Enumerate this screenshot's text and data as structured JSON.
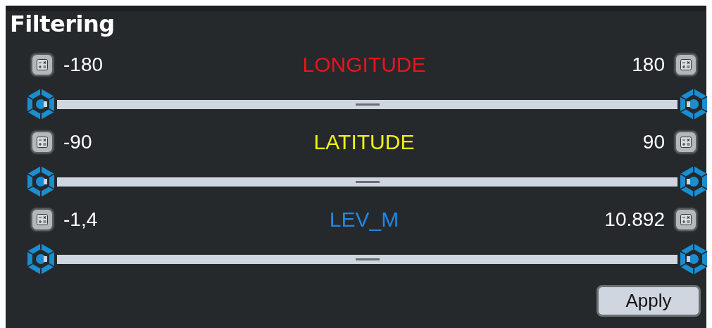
{
  "title": "Filtering",
  "filters": [
    {
      "label": "LONGITUDE",
      "color": "#e8141c",
      "min": "-180",
      "max": "180"
    },
    {
      "label": "LATITUDE",
      "color": "#f2f20f",
      "min": "-90",
      "max": "90"
    },
    {
      "label": "LEV_M",
      "color": "#1e88e8",
      "min": "-1,4",
      "max": "10.892"
    }
  ],
  "apply_button": "Apply"
}
